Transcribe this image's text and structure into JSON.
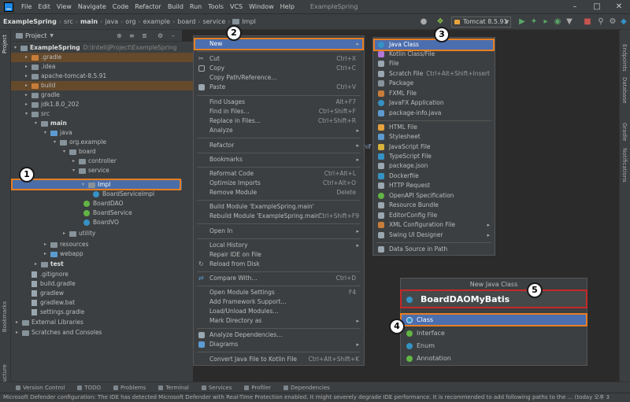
{
  "menubar": {
    "items": [
      "File",
      "Edit",
      "View",
      "Navigate",
      "Code",
      "Refactor",
      "Build",
      "Run",
      "Tools",
      "VCS",
      "Window",
      "Help"
    ],
    "window_title": "ExampleSpring"
  },
  "navbar": {
    "crumbs": [
      "ExampleSpring",
      "src",
      "main",
      "java",
      "org",
      "example",
      "board",
      "service",
      "Impl"
    ],
    "run_config": "Tomcat 8.5.91"
  },
  "project_panel": {
    "title": "Project",
    "tree": [
      {
        "label": "ExampleSpring",
        "extra": "D:\\IntelliJProject\\ExampleSpring",
        "icon": "folder"
      },
      {
        "label": ".gradle",
        "icon": "folder"
      },
      {
        "label": ".idea",
        "icon": "folder"
      },
      {
        "label": "apache-tomcat-8.5.91",
        "icon": "folder"
      },
      {
        "label": "build",
        "icon": "folder"
      },
      {
        "label": "gradle",
        "icon": "folder"
      },
      {
        "label": "jdk1.8.0_202",
        "icon": "folder"
      },
      {
        "label": "src",
        "icon": "folder"
      },
      {
        "label": "main",
        "icon": "folder"
      },
      {
        "label": "java",
        "icon": "folder"
      },
      {
        "label": "org.example",
        "icon": "folder"
      },
      {
        "label": "board",
        "icon": "folder"
      },
      {
        "label": "controller",
        "icon": "folder"
      },
      {
        "label": "service",
        "icon": "folder"
      },
      {
        "label": "Impl",
        "icon": "folder"
      },
      {
        "label": "BoardServiceImpl",
        "icon": "class"
      },
      {
        "label": "BoardDAO",
        "icon": "class"
      },
      {
        "label": "BoardService",
        "icon": "class"
      },
      {
        "label": "BoardVO",
        "icon": "class"
      },
      {
        "label": "utility",
        "icon": "folder"
      },
      {
        "label": "resources",
        "icon": "folder"
      },
      {
        "label": "webapp",
        "icon": "folder"
      },
      {
        "label": "test",
        "icon": "folder"
      },
      {
        "label": ".gitignore",
        "icon": "file"
      },
      {
        "label": "build.gradle",
        "icon": "file"
      },
      {
        "label": "gradlew",
        "icon": "file"
      },
      {
        "label": "gradlew.bat",
        "icon": "file"
      },
      {
        "label": "settings.gradle",
        "icon": "file"
      },
      {
        "label": "External Libraries",
        "icon": "lib"
      },
      {
        "label": "Scratches and Consoles",
        "icon": "lib"
      }
    ]
  },
  "left_strip": {
    "project": "Project",
    "bookmarks": "Bookmarks",
    "structure": "Structure"
  },
  "right_strip": {
    "endpoints": "Endpoints",
    "database": "Database",
    "gradle": "Gradle",
    "notifications": "Notifications"
  },
  "context_menu": {
    "items": [
      {
        "label": "New",
        "shortcut": "",
        "submenu": true
      },
      {
        "label": "Cut",
        "shortcut": "Ctrl+X"
      },
      {
        "label": "Copy",
        "shortcut": "Ctrl+C"
      },
      {
        "label": "Copy Path/Reference...",
        "shortcut": ""
      },
      {
        "label": "Paste",
        "shortcut": "Ctrl+V"
      },
      {
        "label": "Find Usages",
        "shortcut": "Alt+F7"
      },
      {
        "label": "Find in Files...",
        "shortcut": "Ctrl+Shift+F"
      },
      {
        "label": "Replace in Files...",
        "shortcut": "Ctrl+Shift+R"
      },
      {
        "label": "Analyze",
        "shortcut": "",
        "submenu": true
      },
      {
        "label": "Refactor",
        "shortcut": "",
        "submenu": true
      },
      {
        "label": "Bookmarks",
        "shortcut": "",
        "submenu": true
      },
      {
        "label": "Reformat Code",
        "shortcut": "Ctrl+Alt+L"
      },
      {
        "label": "Optimize Imports",
        "shortcut": "Ctrl+Alt+O"
      },
      {
        "label": "Remove Module",
        "shortcut": "Delete"
      },
      {
        "label": "Build Module 'ExampleSpring.main'",
        "shortcut": ""
      },
      {
        "label": "Rebuild Module 'ExampleSpring.main'",
        "shortcut": "Ctrl+Shift+F9"
      },
      {
        "label": "Open In",
        "shortcut": "",
        "submenu": true
      },
      {
        "label": "Local History",
        "shortcut": "",
        "submenu": true
      },
      {
        "label": "Repair IDE on File",
        "shortcut": ""
      },
      {
        "label": "Reload from Disk",
        "shortcut": ""
      },
      {
        "label": "Compare With...",
        "shortcut": "Ctrl+D"
      },
      {
        "label": "Open Module Settings",
        "shortcut": "F4"
      },
      {
        "label": "Add Framework Support...",
        "shortcut": ""
      },
      {
        "label": "Load/Unload Modules...",
        "shortcut": ""
      },
      {
        "label": "Mark Directory as",
        "shortcut": "",
        "submenu": true
      },
      {
        "label": "Analyze Dependencies...",
        "shortcut": ""
      },
      {
        "label": "Diagrams",
        "shortcut": "",
        "submenu": true
      },
      {
        "label": "Convert Java File to Kotlin File",
        "shortcut": "Ctrl+Alt+Shift+K"
      }
    ]
  },
  "new_submenu": {
    "items": [
      {
        "label": "Java Class",
        "shortcut": ""
      },
      {
        "label": "Kotlin Class/File",
        "shortcut": ""
      },
      {
        "label": "File",
        "shortcut": ""
      },
      {
        "label": "Scratch File",
        "shortcut": "Ctrl+Alt+Shift+Insert"
      },
      {
        "label": "Package",
        "shortcut": ""
      },
      {
        "label": "FXML File",
        "shortcut": ""
      },
      {
        "label": "JavaFX Application",
        "shortcut": ""
      },
      {
        "label": "package-info.java",
        "shortcut": ""
      },
      {
        "label": "HTML File",
        "shortcut": ""
      },
      {
        "label": "Stylesheet",
        "shortcut": ""
      },
      {
        "label": "JavaScript File",
        "shortcut": ""
      },
      {
        "label": "TypeScript File",
        "shortcut": ""
      },
      {
        "label": "package.json",
        "shortcut": ""
      },
      {
        "label": "Dockerfile",
        "shortcut": ""
      },
      {
        "label": "HTTP Request",
        "shortcut": ""
      },
      {
        "label": "OpenAPI Specification",
        "shortcut": ""
      },
      {
        "label": "Resource Bundle",
        "shortcut": ""
      },
      {
        "label": "EditorConfig File",
        "shortcut": ""
      },
      {
        "label": "XML Configuration File",
        "shortcut": "",
        "submenu": true
      },
      {
        "label": "Swing UI Designer",
        "shortcut": "",
        "submenu": true
      },
      {
        "label": "Data Source in Path",
        "shortcut": ""
      }
    ]
  },
  "dialog": {
    "title": "New Java Class",
    "name_value": "BoardDAOMyBatis",
    "kinds": [
      "Class",
      "Interface",
      "Enum",
      "Annotation"
    ]
  },
  "editor": {
    "partial_text": "hif"
  },
  "bottom_tools": [
    "Version Control",
    "TODO",
    "Problems",
    "Terminal",
    "Services",
    "Profiler",
    "Dependencies"
  ],
  "status_text": "Microsoft Defender configuration: The IDE has detected Microsoft Defender with Real-Time Protection enabled. It might severely degrade IDE performance. It is recommended to add following paths to the ... (today 오후 3",
  "annotations": [
    "1",
    "2",
    "3",
    "4",
    "5"
  ],
  "colors": {
    "selection": "#4b6eaf",
    "highlight_box": "#e67e22",
    "name_box": "#c62828"
  }
}
